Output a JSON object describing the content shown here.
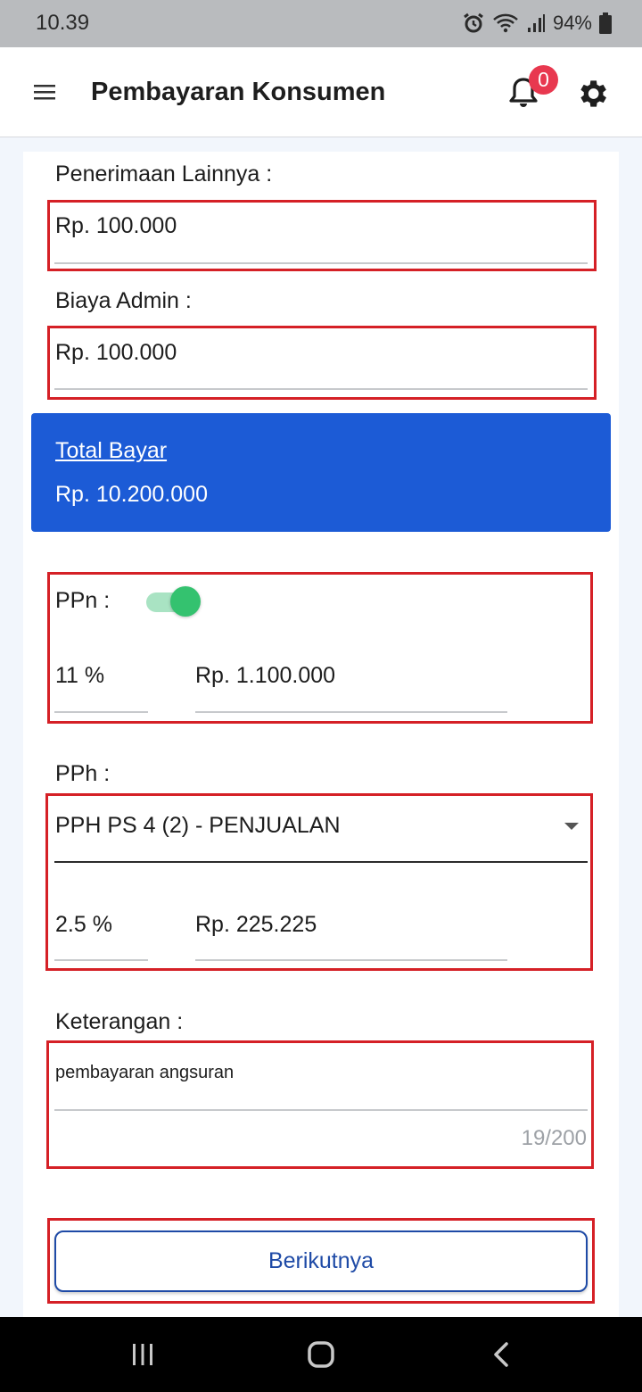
{
  "status_bar": {
    "time": "10.39",
    "battery": "94%"
  },
  "app_bar": {
    "title": "Pembayaran Konsumen",
    "notification_count": "0"
  },
  "form": {
    "penerimaan_lainnya": {
      "label": "Penerimaan Lainnya :",
      "value": "Rp. 100.000"
    },
    "biaya_admin": {
      "label": "Biaya Admin :",
      "value": "Rp. 100.000"
    },
    "total_bayar": {
      "label": "Total Bayar",
      "value": "Rp. 10.200.000"
    },
    "ppn": {
      "label": "PPn :",
      "enabled": true,
      "rate": "11 %",
      "amount": "Rp. 1.100.000"
    },
    "pph": {
      "label": "PPh :",
      "selected": "PPH PS 4 (2) - PENJUALAN",
      "rate": "2.5 %",
      "amount": "Rp. 225.225"
    },
    "keterangan": {
      "label": "Keterangan :",
      "value": "pembayaran angsuran",
      "counter": "19/200"
    }
  },
  "next_button": {
    "label": "Berikutnya"
  },
  "colors": {
    "accent": "#1c5bd6",
    "highlight": "#d52026",
    "toggle": "#34c26f",
    "badge": "#e8384f"
  }
}
